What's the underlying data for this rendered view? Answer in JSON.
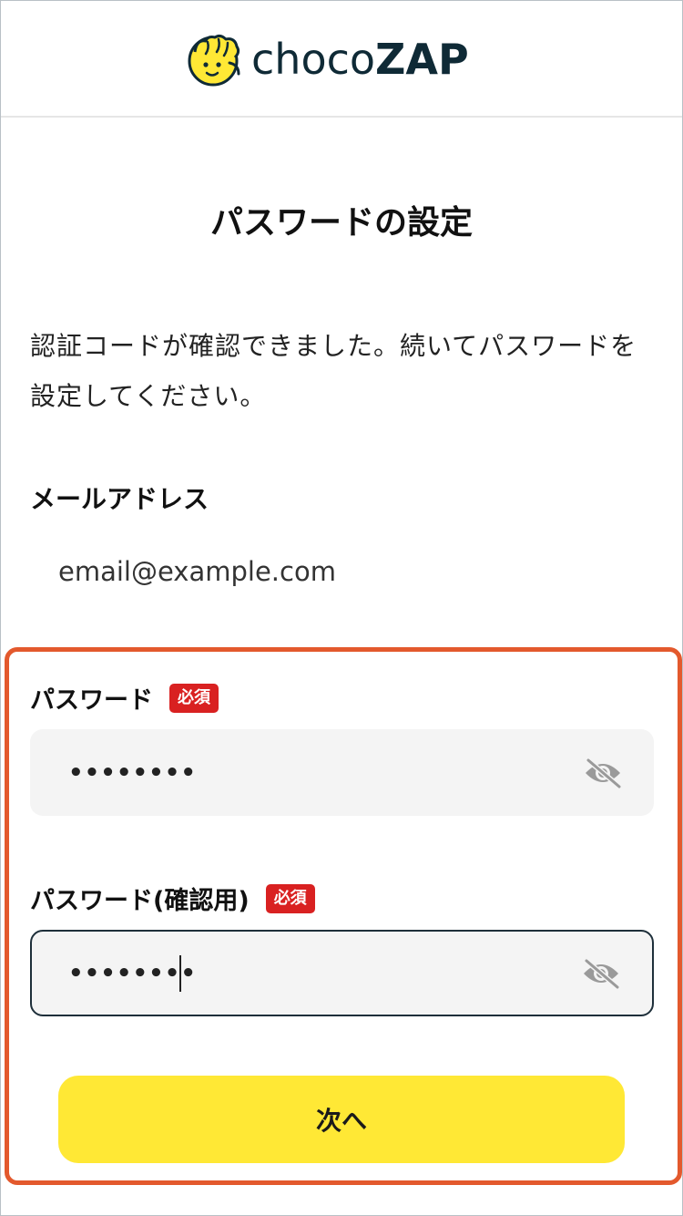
{
  "header": {
    "logo_text_light": "choco",
    "logo_text_bold": "ZAP",
    "logo_color": "#ffe835"
  },
  "page": {
    "title": "パスワードの設定",
    "description": "認証コードが確認できました。続いてパスワードを設定してください。"
  },
  "email": {
    "label": "メールアドレス",
    "value": "email@example.com"
  },
  "password": {
    "label": "パスワード",
    "required_badge": "必須",
    "value": "••••••••",
    "toggle_icon": "eye-off-icon"
  },
  "password_confirm": {
    "label": "パスワード(確認用)",
    "required_badge": "必須",
    "value": "••••••••",
    "toggle_icon": "eye-off-icon"
  },
  "actions": {
    "next_label": "次へ"
  },
  "colors": {
    "accent_yellow": "#ffe835",
    "required_red": "#d92121",
    "highlight_orange": "#e3592d",
    "text_navy": "#0f2a36"
  }
}
